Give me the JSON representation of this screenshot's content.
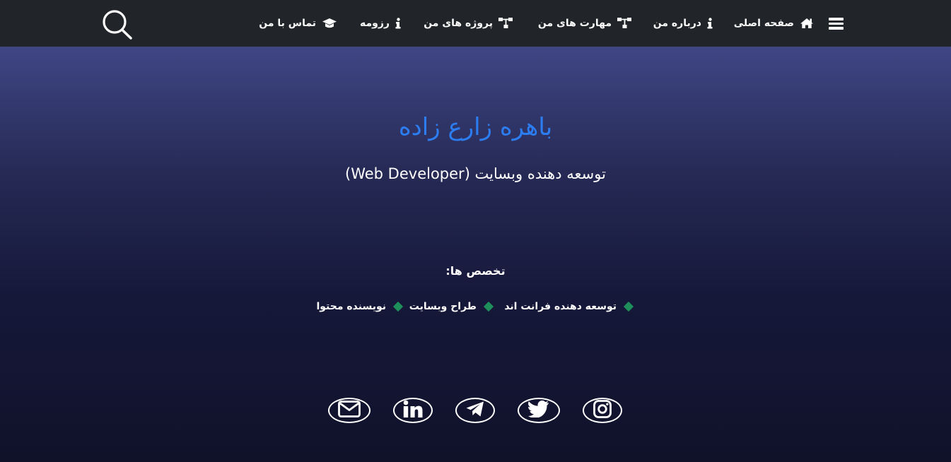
{
  "nav": {
    "items": [
      {
        "label": "صفحه اصلی",
        "icon": "home-icon"
      },
      {
        "label": "درباره من",
        "icon": "info-icon"
      },
      {
        "label": "مهارت های من",
        "icon": "sitemap-icon"
      },
      {
        "label": "پروژه های من",
        "icon": "sitemap-icon"
      },
      {
        "label": "رزومه",
        "icon": "info-icon"
      },
      {
        "label": "تماس با من",
        "icon": "graduation-cap-icon"
      }
    ],
    "menu_icon": "hamburger-menu-icon",
    "search_icon": "search-icon"
  },
  "hero": {
    "name": "باهره زارع زاده",
    "role": "توسعه دهنده وبسایت (Web Developer)",
    "specialties_title": "تخصص ها:",
    "specialties": [
      "توسعه دهنده فرانت اند",
      "طراح وبسایت",
      "نویسنده محتوا"
    ]
  },
  "social": [
    {
      "name": "instagram",
      "icon": "instagram-icon"
    },
    {
      "name": "twitter",
      "icon": "twitter-icon"
    },
    {
      "name": "telegram",
      "icon": "telegram-icon"
    },
    {
      "name": "linkedin",
      "icon": "linkedin-icon"
    },
    {
      "name": "email",
      "icon": "email-icon"
    }
  ],
  "colors": {
    "navbar": "#212529",
    "accent_blue": "#2c7df2",
    "diamond_green": "#1e8f5a",
    "bg_top": "#3f4684",
    "bg_bottom": "#10122a"
  }
}
